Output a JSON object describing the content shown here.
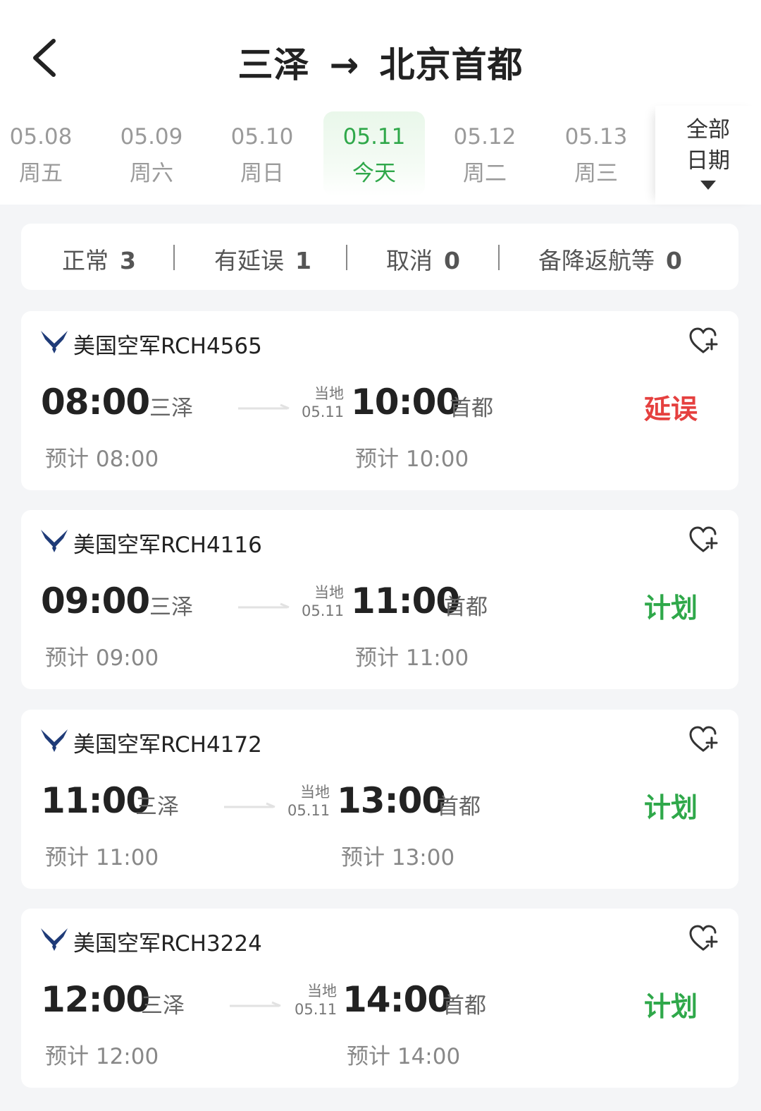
{
  "header": {
    "origin": "三泽",
    "arrow": "→",
    "destination": "北京首都"
  },
  "dates": [
    {
      "date": "05.08",
      "weekday": "周五",
      "active": false
    },
    {
      "date": "05.09",
      "weekday": "周六",
      "active": false
    },
    {
      "date": "05.10",
      "weekday": "周日",
      "active": false
    },
    {
      "date": "05.11",
      "weekday": "今天",
      "active": true
    },
    {
      "date": "05.12",
      "weekday": "周二",
      "active": false
    },
    {
      "date": "05.13",
      "weekday": "周三",
      "active": false
    }
  ],
  "all_dates": {
    "line1": "全部",
    "line2": "日期"
  },
  "summary": {
    "normal_label": "正常",
    "normal_count": "3",
    "delayed_label": "有延误",
    "delayed_count": "1",
    "cancelled_label": "取消",
    "cancelled_count": "0",
    "diverted_label": "备降返航等",
    "diverted_count": "0"
  },
  "colors": {
    "accent_green": "#2fa84a",
    "delay_red": "#e5403f"
  },
  "flights": [
    {
      "airline_icon": "us-air-force-logo",
      "flight": "美国空军RCH4565",
      "dep_time": "08:00",
      "dep_city": "三泽",
      "local_label": "当地",
      "arr_date": "05.11",
      "arr_time": "10:00",
      "arr_city": "首都",
      "status": "延误",
      "status_type": "delay",
      "est_dep": "预计 08:00",
      "est_arr": "预计 10:00"
    },
    {
      "airline_icon": "us-air-force-logo",
      "flight": "美国空军RCH4116",
      "dep_time": "09:00",
      "dep_city": "三泽",
      "local_label": "当地",
      "arr_date": "05.11",
      "arr_time": "11:00",
      "arr_city": "首都",
      "status": "计划",
      "status_type": "planned",
      "est_dep": "预计 09:00",
      "est_arr": "预计 11:00"
    },
    {
      "airline_icon": "us-air-force-logo",
      "flight": "美国空军RCH4172",
      "dep_time": "11:00",
      "dep_city": "三泽",
      "local_label": "当地",
      "arr_date": "05.11",
      "arr_time": "13:00",
      "arr_city": "首都",
      "status": "计划",
      "status_type": "planned",
      "est_dep": "预计 11:00",
      "est_arr": "预计 13:00"
    },
    {
      "airline_icon": "us-air-force-logo",
      "flight": "美国空军RCH3224",
      "dep_time": "12:00",
      "dep_city": "三泽",
      "local_label": "当地",
      "arr_date": "05.11",
      "arr_time": "14:00",
      "arr_city": "首都",
      "status": "计划",
      "status_type": "planned",
      "est_dep": "预计 12:00",
      "est_arr": "预计 14:00"
    }
  ]
}
